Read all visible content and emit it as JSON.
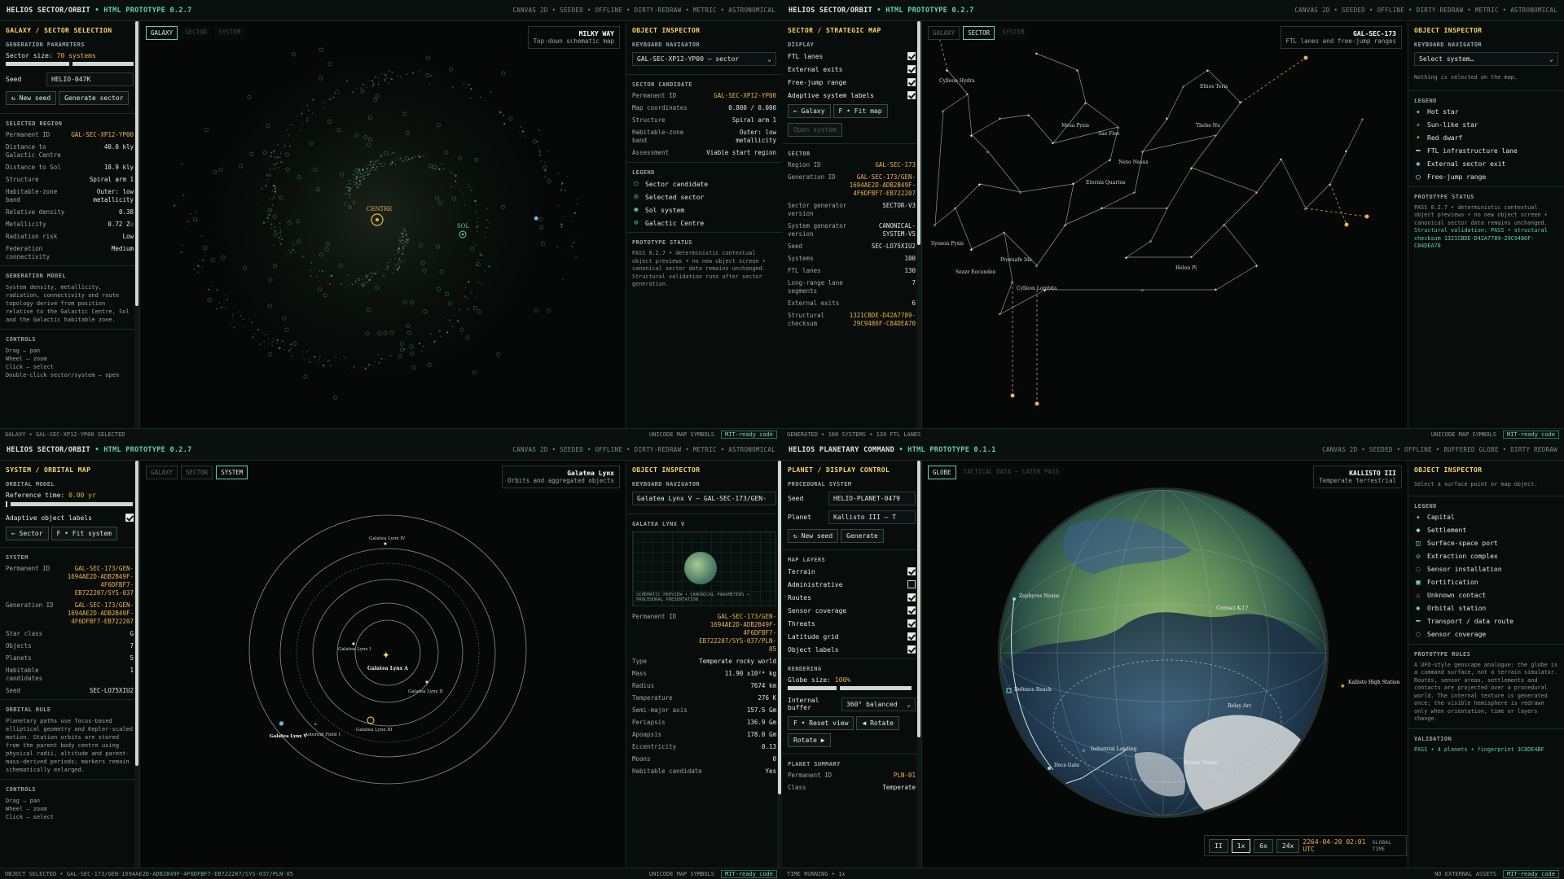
{
  "q1": {
    "header": {
      "app": "HELIOS SECTOR/ORBIT",
      "build": "• HTML PROTOTYPE 0.2.7",
      "flags": "CANVAS 2D • SEEDED • OFFLINE • DIRTY-REDRAW • METRIC • ASTRONOMICAL"
    },
    "left": {
      "title": "GALAXY / SECTOR SELECTION",
      "gen_params": "GENERATION PARAMETERS",
      "sector_size_label": "Sector size:",
      "sector_size_value": "70 systems",
      "seed_label": "Seed",
      "seed_value": "HELIO-047K",
      "new_seed": "↻ New seed",
      "generate": "Generate sector",
      "region_head": "SELECTED REGION",
      "region": [
        {
          "k": "Permanent ID",
          "v": "GAL-SEC-XP12-YP00",
          "hl": true
        },
        {
          "k": "Distance to Galactic Centre",
          "v": "40.0 kly"
        },
        {
          "k": "Distance to Sol",
          "v": "18.9 kly"
        },
        {
          "k": "Structure",
          "v": "Spiral arm 1"
        },
        {
          "k": "Habitable-zone band",
          "v": "Outer: low metallicity"
        },
        {
          "k": "Relative density",
          "v": "0.38"
        },
        {
          "k": "Metallicity",
          "v": "0.72 Z☉"
        },
        {
          "k": "Radiation risk",
          "v": "Low"
        },
        {
          "k": "Federation connectivity",
          "v": "Medium"
        }
      ],
      "model_head": "GENERATION MODEL",
      "model_text": "System density, metallicity, radiation, connectivity and route topology derive from position relative to the Galactic Centre, Sol and the Galactic habitable zone.",
      "controls_head": "CONTROLS",
      "controls": [
        "Drag – pan",
        "Wheel – zoom",
        "Click – select",
        "Double-click sector/system – open"
      ]
    },
    "tabs": [
      "GALAXY",
      "SECTOR",
      "SYSTEM"
    ],
    "badge": {
      "title": "MILKY WAY",
      "sub": "Top-down schematic map"
    },
    "map_labels": {
      "centre": "CENTRE",
      "sol": "SOL"
    },
    "right": {
      "title": "OBJECT INSPECTOR",
      "nav_head": "KEYBOARD NAVIGATOR",
      "nav_value": "GAL-SEC-XP12-YP00 — sector",
      "cand_head": "SECTOR CANDIDATE",
      "cand": [
        {
          "k": "Permanent ID",
          "v": "GAL-SEC-XP12-YP00",
          "hl": true
        },
        {
          "k": "Map coordinates",
          "v": "0.800 / 0.000"
        },
        {
          "k": "Structure",
          "v": "Spiral arm 1"
        },
        {
          "k": "Habitable-zone band",
          "v": "Outer: low metallicity"
        },
        {
          "k": "Assessment",
          "v": "Viable start region"
        }
      ],
      "legend_head": "LEGEND",
      "legend": [
        {
          "sym": "○",
          "label": "Sector candidate",
          "color": "#5fd3ad"
        },
        {
          "sym": "◎",
          "label": "Selected sector",
          "color": "#5fd3ad"
        },
        {
          "sym": "◉",
          "label": "Sol system",
          "color": "#5fd3ad"
        },
        {
          "sym": "⊙",
          "label": "Galactic Centre",
          "color": "#5fd3ad"
        }
      ],
      "status_head": "PROTOTYPE STATUS",
      "status_text": "PASS 0.2.7 • deterministic contextual object previews • no new object screen • canonical sector data remains unchanged. Structural validation runs after sector generation."
    },
    "footer": {
      "left": "GALAXY • GAL-SEC-XP12-YP00 SELECTED",
      "right": "UNICODE MAP SYMBOLS",
      "badge": "MIT-ready code"
    }
  },
  "q2": {
    "header": {
      "app": "HELIOS SECTOR/ORBIT",
      "build": "• HTML PROTOTYPE 0.2.7",
      "flags": "CANVAS 2D • SEEDED • OFFLINE • DIRTY-REDRAW • METRIC • ASTRONOMICAL"
    },
    "left": {
      "title": "SECTOR / STRATEGIC MAP",
      "display_head": "DISPLAY",
      "display": [
        {
          "label": "FTL lanes",
          "on": true
        },
        {
          "label": "External exits",
          "on": true
        },
        {
          "label": "Free-jump range",
          "on": true
        },
        {
          "label": "Adaptive system labels",
          "on": true
        }
      ],
      "btn_galaxy": "← Galaxy",
      "btn_fit": "F • Fit map",
      "btn_open": "Open system",
      "sector_head": "SECTOR",
      "sector": [
        {
          "k": "Region ID",
          "v": "GAL-SEC-173",
          "hl": true
        },
        {
          "k": "Generation ID",
          "v": "GAL-SEC-173/GEN-1694AE2D-ADB2B49F-4F6DFBF7-EB722207",
          "hl": true
        },
        {
          "k": "Sector generator version",
          "v": "SECTOR-V3"
        },
        {
          "k": "System generator version",
          "v": "CANONICAL-SYSTEM-V5"
        },
        {
          "k": "Seed",
          "v": "SEC-LO75XIU2"
        },
        {
          "k": "Systems",
          "v": "100"
        },
        {
          "k": "FTL lanes",
          "v": "130"
        },
        {
          "k": "Long-range lane segments",
          "v": "7"
        },
        {
          "k": "External exits",
          "v": "6"
        },
        {
          "k": "Structural checksum",
          "v": "1321CBDE-D42A7789-29C9486F-C84DEA70",
          "hl": true
        }
      ]
    },
    "tabs": [
      "GALAXY",
      "SECTOR",
      "SYSTEM"
    ],
    "badge": {
      "title": "GAL-SEC-173",
      "sub": "FTL lanes and free-jump ranges"
    },
    "star_labels": [
      "Cylleon Hydra",
      "Mesa Pyxis",
      "Sae Fleo",
      "Nexo Nesus",
      "Eternis Quartus",
      "Thebe Nu",
      "Ethos Teris",
      "Syenon Pyxis",
      "Seazr Eecunden",
      "Proxuafe Ida",
      "Cylleon Lambda",
      "Helon Pi"
    ],
    "right": {
      "title": "OBJECT INSPECTOR",
      "nav_head": "KEYBOARD NAVIGATOR",
      "nav_value": "Select system…",
      "empty": "Nothing is selected on the map.",
      "legend_head": "LEGEND",
      "legend": [
        {
          "sym": "✦",
          "label": "Hot star",
          "color": "#9fe3ff"
        },
        {
          "sym": "✧",
          "label": "Sun-like star",
          "color": "#ffe6a0"
        },
        {
          "sym": "•",
          "label": "Red dwarf",
          "color": "#ff9b6b"
        },
        {
          "sym": "━",
          "label": "FTL infrastructure lane",
          "color": "#cfd8d3"
        },
        {
          "sym": "✺",
          "label": "External sector exit",
          "color": "#7fd0ff"
        },
        {
          "sym": "◯",
          "label": "Free-jump range",
          "color": "#cfd8d3"
        }
      ],
      "status_head": "PROTOTYPE STATUS",
      "status_text": "PASS 0.2.7 • deterministic contextual object previews • no new object screen • canonical sector data remains unchanged.",
      "status_pass": "Structural validation: PASS • structural checksum 1321CBDE-D42A7789-29C9486F-C84DEA70"
    },
    "footer": {
      "left": "GENERATED • 100 SYSTEMS • 130 FTL LANES",
      "right": "UNICODE MAP SYMBOLS",
      "badge": "MIT-ready code"
    }
  },
  "q3": {
    "header": {
      "app": "HELIOS SECTOR/ORBIT",
      "build": "• HTML PROTOTYPE 0.2.7",
      "flags": "CANVAS 2D • SEEDED • OFFLINE • DIRTY-REDRAW • METRIC • ASTRONOMICAL"
    },
    "left": {
      "title": "SYSTEM / ORBITAL MAP",
      "model_head": "ORBITAL MODEL",
      "ref_label": "Reference time:",
      "ref_value": "0.00 yr",
      "adaptive": "Adaptive object labels",
      "btn_sector": "← Sector",
      "btn_fit": "F • Fit system",
      "system_head": "SYSTEM",
      "system": [
        {
          "k": "Permanent ID",
          "v": "GAL-SEC-173/GEN-1694AE2D-ADB2B49F-4F6DFBF7-EB722207/SYS-037",
          "hl": true
        },
        {
          "k": "Generation ID",
          "v": "GAL-SEC-173/GEN-1694AE2D-ADB2B49F-4F6DFBF7-EB722207",
          "hl": true
        },
        {
          "k": "Star class",
          "v": "G"
        },
        {
          "k": "Objects",
          "v": "7"
        },
        {
          "k": "Planets",
          "v": "5"
        },
        {
          "k": "Habitable candidates",
          "v": "1"
        },
        {
          "k": "Seed",
          "v": "SEC-LO75XIU2"
        }
      ],
      "rule_head": "ORBITAL RULE",
      "rule_text": "Planetary paths use focus-based elliptical geometry and Kepler-scaled motion. Station orbits are stored from the parent body centre using physical radii, altitude and parent-mass-derived periods; markers remain schematically enlarged.",
      "controls_head": "CONTROLS",
      "controls": [
        "Drag – pan",
        "Wheel – zoom",
        "Click – select"
      ]
    },
    "tabs": [
      "GALAXY",
      "SECTOR",
      "SYSTEM"
    ],
    "badge": {
      "title": "Galatea Lynx",
      "sub": "Orbits and aggregated objects"
    },
    "orbit_labels": {
      "star": "Galatea Lynx A",
      "i": "Galatea Lynx I",
      "ii": "Galatea Lynx II",
      "iii": "Galatea Lynx III",
      "iv": "Galatea Lynx IV",
      "v": "Galatea Lynx V",
      "belt": "Asteroid Field 1"
    },
    "right": {
      "title": "OBJECT INSPECTOR",
      "nav_head": "KEYBOARD NAVIGATOR",
      "nav_value": "Galatea Lynx V — GAL-SEC-173/GEN-",
      "obj_head": "GALATEA LYNX V",
      "preview_caption": "SCHEMATIC PREVIEW • CANONICAL PARAMETERS • PROCEDURAL PRESENTATION",
      "obj": [
        {
          "k": "Permanent ID",
          "v": "GAL-SEC-173/GEN-1694AE2D-ADB2B49F-4F6DFBF7-EB722207/SYS-037/PLN-05",
          "hl": true
        },
        {
          "k": "Type",
          "v": "Temperate rocky world"
        },
        {
          "k": "Mass",
          "v": "11.90 x10²⁴ kg"
        },
        {
          "k": "Radius",
          "v": "7674 km"
        },
        {
          "k": "Temperature",
          "v": "276 K"
        },
        {
          "k": "Semi-major axis",
          "v": "157.5 Gm"
        },
        {
          "k": "Periapsis",
          "v": "136.9 Gm"
        },
        {
          "k": "Apoapsis",
          "v": "178.0 Gm"
        },
        {
          "k": "Eccentricity",
          "v": "0.13"
        },
        {
          "k": "Moons",
          "v": "0"
        },
        {
          "k": "Habitable candidate",
          "v": "Yes"
        }
      ]
    },
    "footer": {
      "left": "OBJECT SELECTED • GAL-SEC-173/GEN-1694AE2D-ADB2B49F-4F6DFBF7-EB722207/SYS-037/PLN-05",
      "right": "UNICODE MAP SYMBOLS",
      "badge": "MIT-ready code"
    }
  },
  "q4": {
    "header": {
      "app": "HELIOS PLANETARY COMMAND",
      "build": "• HTML PROTOTYPE 0.1.1",
      "flags": "CANVAS 2D • SEEDED • OFFLINE • BUFFERED GLOBE • DIRTY REDRAW"
    },
    "left": {
      "title": "PLANET / DISPLAY CONTROL",
      "proc_head": "PROCEDURAL SYSTEM",
      "seed_label": "Seed",
      "seed_value": "HELIO-PLANET-0479",
      "planet_label": "Planet",
      "planet_value": "Kallisto III — T",
      "new_seed": "↻ New seed",
      "generate": "Generate",
      "layers_head": "MAP LAYERS",
      "layers": [
        {
          "label": "Terrain",
          "on": true
        },
        {
          "label": "Administrative",
          "on": false
        },
        {
          "label": "Routes",
          "on": true
        },
        {
          "label": "Sensor coverage",
          "on": true
        },
        {
          "label": "Threats",
          "on": true
        },
        {
          "label": "Latitude grid",
          "on": true
        },
        {
          "label": "Object labels",
          "on": true
        }
      ],
      "render_head": "RENDERING",
      "globe_label": "Globe size:",
      "globe_value": "100%",
      "buffer_label": "Internal buffer",
      "buffer_value": "360° balanced",
      "reset": "F • Reset view",
      "rotate_a": "◀ Rotate",
      "rotate_b": "Rotate ▶",
      "summary_head": "PLANET SUMMARY",
      "summary": [
        {
          "k": "Permanent ID",
          "v": "PLN-01",
          "hl": true
        },
        {
          "k": "Class",
          "v": "Temperate"
        }
      ]
    },
    "tabs": [
      "GLOBE",
      "TACTICAL DATA — LATER PASS"
    ],
    "badge": {
      "title": "KALLISTO III",
      "sub": "Temperate terrestrial"
    },
    "globe_labels": {
      "zephyros": "Zephyros Nexus",
      "contact": "Contact K-17",
      "station": "Kallisto High Station",
      "defence": "Defence Reach",
      "relay": "Relay Arc",
      "industrial": "Industrial Landing",
      "docs": "Docs Gate",
      "sensor": "Sensor Nexus"
    },
    "time": {
      "pause": "II",
      "x1": "1x",
      "x6": "6x",
      "x24": "24x",
      "clock": "2264-04-20 02:01 UTC",
      "global": "GLOBAL TIME"
    },
    "right": {
      "title": "OBJECT INSPECTOR",
      "hint": "Select a surface point or map object.",
      "legend_head": "LEGEND",
      "legend": [
        {
          "sym": "✦",
          "label": "Capital",
          "color": "#7fe7d0"
        },
        {
          "sym": "◆",
          "label": "Settlement",
          "color": "#7fe7d0"
        },
        {
          "sym": "◫",
          "label": "Surface-space port",
          "color": "#7fe7d0"
        },
        {
          "sym": "◇",
          "label": "Extraction complex",
          "color": "#7fe7d0"
        },
        {
          "sym": "◌",
          "label": "Sensor installation",
          "color": "#7fe7d0"
        },
        {
          "sym": "▣",
          "label": "Fortification",
          "color": "#7fe7d0"
        },
        {
          "sym": "⚠",
          "label": "Unknown contact",
          "color": "#ff8a6b"
        },
        {
          "sym": "✺",
          "label": "Orbital station",
          "color": "#7fe7d0"
        },
        {
          "sym": "━",
          "label": "Transport / data route",
          "color": "#7fe7d0"
        },
        {
          "sym": "◌",
          "label": "Sensor coverage",
          "color": "#7fe7d0"
        }
      ],
      "rules_head": "PROTOTYPE RULES",
      "rules_text": "A UFO-style geoscape analogue: the globe is a command surface, not a terrain simulator. Routes, sensor areas, settlements and contacts are projected over a procedural world. The internal texture is generated once; the visible hemisphere is redrawn only when orientation, time or layers change.",
      "valid_head": "VALIDATION",
      "valid_text": "PASS • 4 planets • fingerprint 3C8DE4BF"
    },
    "footer": {
      "left": "TIME RUNNING • 1x",
      "right": "NO EXTERNAL ASSETS",
      "badge": "MIT-ready code"
    }
  }
}
